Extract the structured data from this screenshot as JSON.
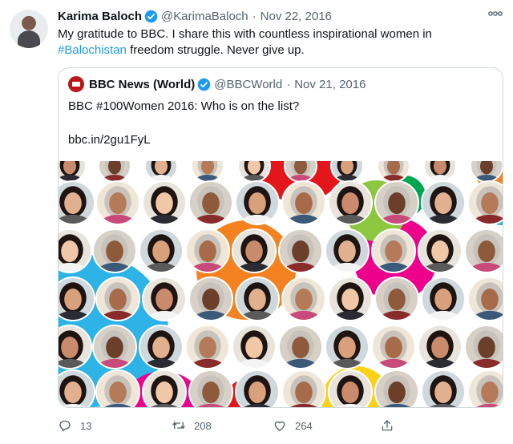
{
  "tweet": {
    "author_name": "Karima Baloch",
    "handle": "@KarimaBaloch",
    "separator": "·",
    "date": "Nov 22, 2016",
    "text_before": "My gratitude to BBC. I share this with countless inspirational women in ",
    "hashtag": "#Balochistan",
    "text_after": " freedom struggle. Never give up."
  },
  "quoted_tweet": {
    "author_name": "BBC News (World)",
    "handle": "@BBCWorld",
    "separator": "·",
    "date": "Nov 21, 2016",
    "text": "BBC #100Women 2016: Who is on the list?",
    "link": "bbc.in/2gu1FyL"
  },
  "actions": {
    "reply_count": "13",
    "retweet_count": "208",
    "like_count": "264"
  },
  "colors": {
    "accent": "#1d9bf0",
    "verified": "#1d9bf0",
    "bbc_red": "#bb1919",
    "muted": "#536471",
    "border": "#cfd9de",
    "image_blobs": [
      "#e3161b",
      "#f58220",
      "#2db3e5",
      "#ec008c",
      "#8dc63f",
      "#fcd116",
      "#00a651"
    ]
  },
  "icons": [
    "verified-badge-icon",
    "more-icon",
    "bbc-news-logo",
    "reply-icon",
    "retweet-icon",
    "like-icon",
    "share-icon"
  ]
}
